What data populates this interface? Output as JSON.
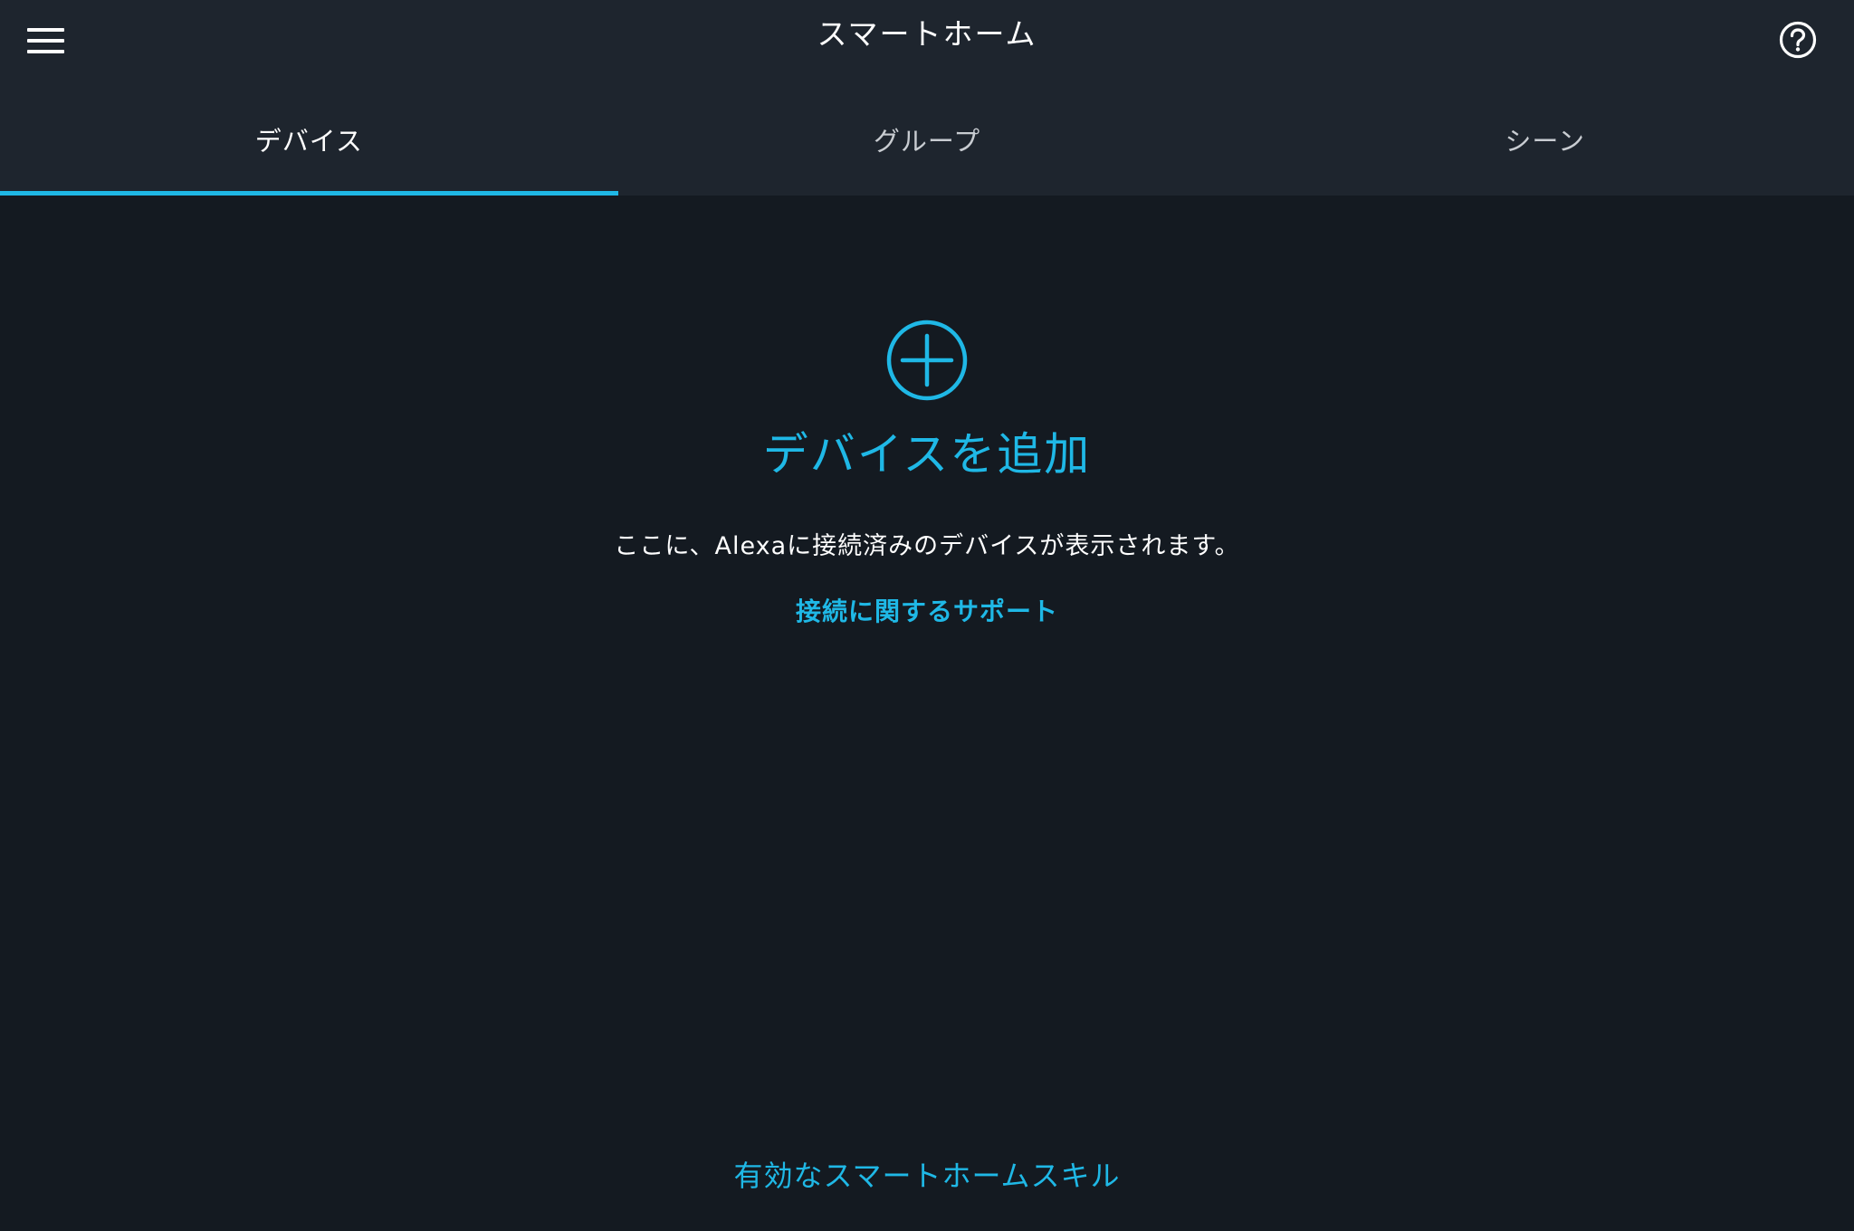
{
  "header": {
    "title": "スマートホーム",
    "menu_icon": "hamburger-menu-icon",
    "help_icon": "help-circle-icon"
  },
  "tabs": [
    {
      "label": "デバイス",
      "active": true
    },
    {
      "label": "グループ",
      "active": false
    },
    {
      "label": "シーン",
      "active": false
    }
  ],
  "main": {
    "add_icon": "plus-circle-icon",
    "add_label": "デバイスを追加",
    "description": "ここに、Alexaに接続済みのデバイスが表示されます。",
    "support_link": "接続に関するサポート",
    "skills_link": "有効なスマートホームスキル"
  },
  "colors": {
    "background": "#141a21",
    "header": "#1e252e",
    "accent": "#1fb8e6",
    "text": "#ffffff"
  }
}
